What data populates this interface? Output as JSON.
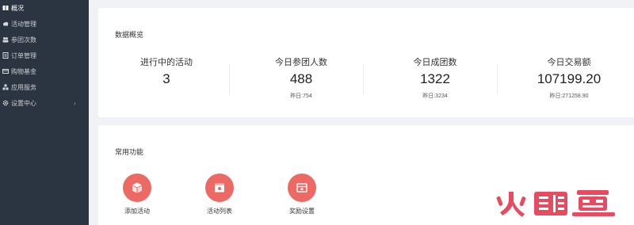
{
  "sidebar": {
    "items": [
      {
        "label": "概况",
        "icon": "book-icon"
      },
      {
        "label": "活动管理",
        "icon": "cloud-icon"
      },
      {
        "label": "参团次数",
        "icon": "users-icon"
      },
      {
        "label": "订单管理",
        "icon": "document-icon"
      },
      {
        "label": "购物基金",
        "icon": "card-icon"
      },
      {
        "label": "应用服务",
        "icon": "cubes-icon"
      },
      {
        "label": "设置中心",
        "icon": "gear-icon",
        "arrow": "›"
      }
    ]
  },
  "overview": {
    "title": "数据概览",
    "stats": [
      {
        "label": "进行中的活动",
        "value": "3",
        "sub": ""
      },
      {
        "label": "今日参团人数",
        "value": "488",
        "sub": "昨日:754"
      },
      {
        "label": "今日成团数",
        "value": "1322",
        "sub": "昨日:3234"
      },
      {
        "label": "今日交易额",
        "value": "107199.20",
        "sub": "昨日:271258.90"
      }
    ]
  },
  "functions": {
    "title": "常用功能",
    "items": [
      {
        "label": "添加活动",
        "icon": "box-icon"
      },
      {
        "label": "活动列表",
        "icon": "list-box-icon"
      },
      {
        "label": "奖励设置",
        "icon": "gift-icon"
      }
    ]
  },
  "watermark": {
    "text": "火鲤鱼"
  },
  "colors": {
    "sidebar": "#2b3441",
    "accent": "#ed6a64",
    "background": "#f0f2f5",
    "watermark": "#e84a5f"
  }
}
